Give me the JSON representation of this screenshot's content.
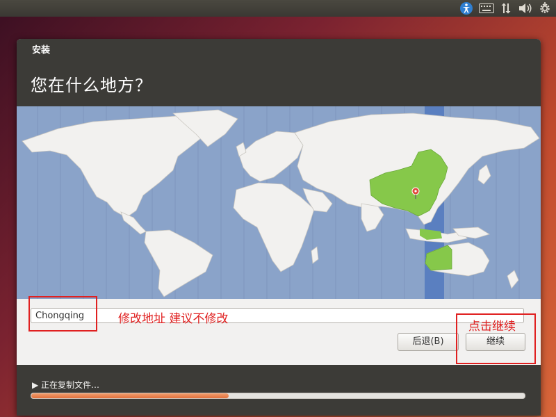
{
  "top_panel": {
    "icons": [
      "accessibility-icon",
      "keyboard-icon",
      "network-icon",
      "volume-icon",
      "gear-icon"
    ]
  },
  "dialog": {
    "window_title": "安装",
    "question": "您在什么地方？",
    "location_value": "Chongqing",
    "back_label": "后退(B)",
    "continue_label": "继续",
    "status_text": "▶ 正在复制文件…",
    "progress": 0.4
  },
  "annotations": {
    "location_note": "修改地址 建议不修改",
    "continue_note": "点击继续"
  },
  "colors": {
    "ocean": "#8aa3c9",
    "land": "#f2f1ef",
    "selected_country": "#86c84a",
    "timezone_band": "#5a7fc0",
    "annotation": "#e02020"
  }
}
